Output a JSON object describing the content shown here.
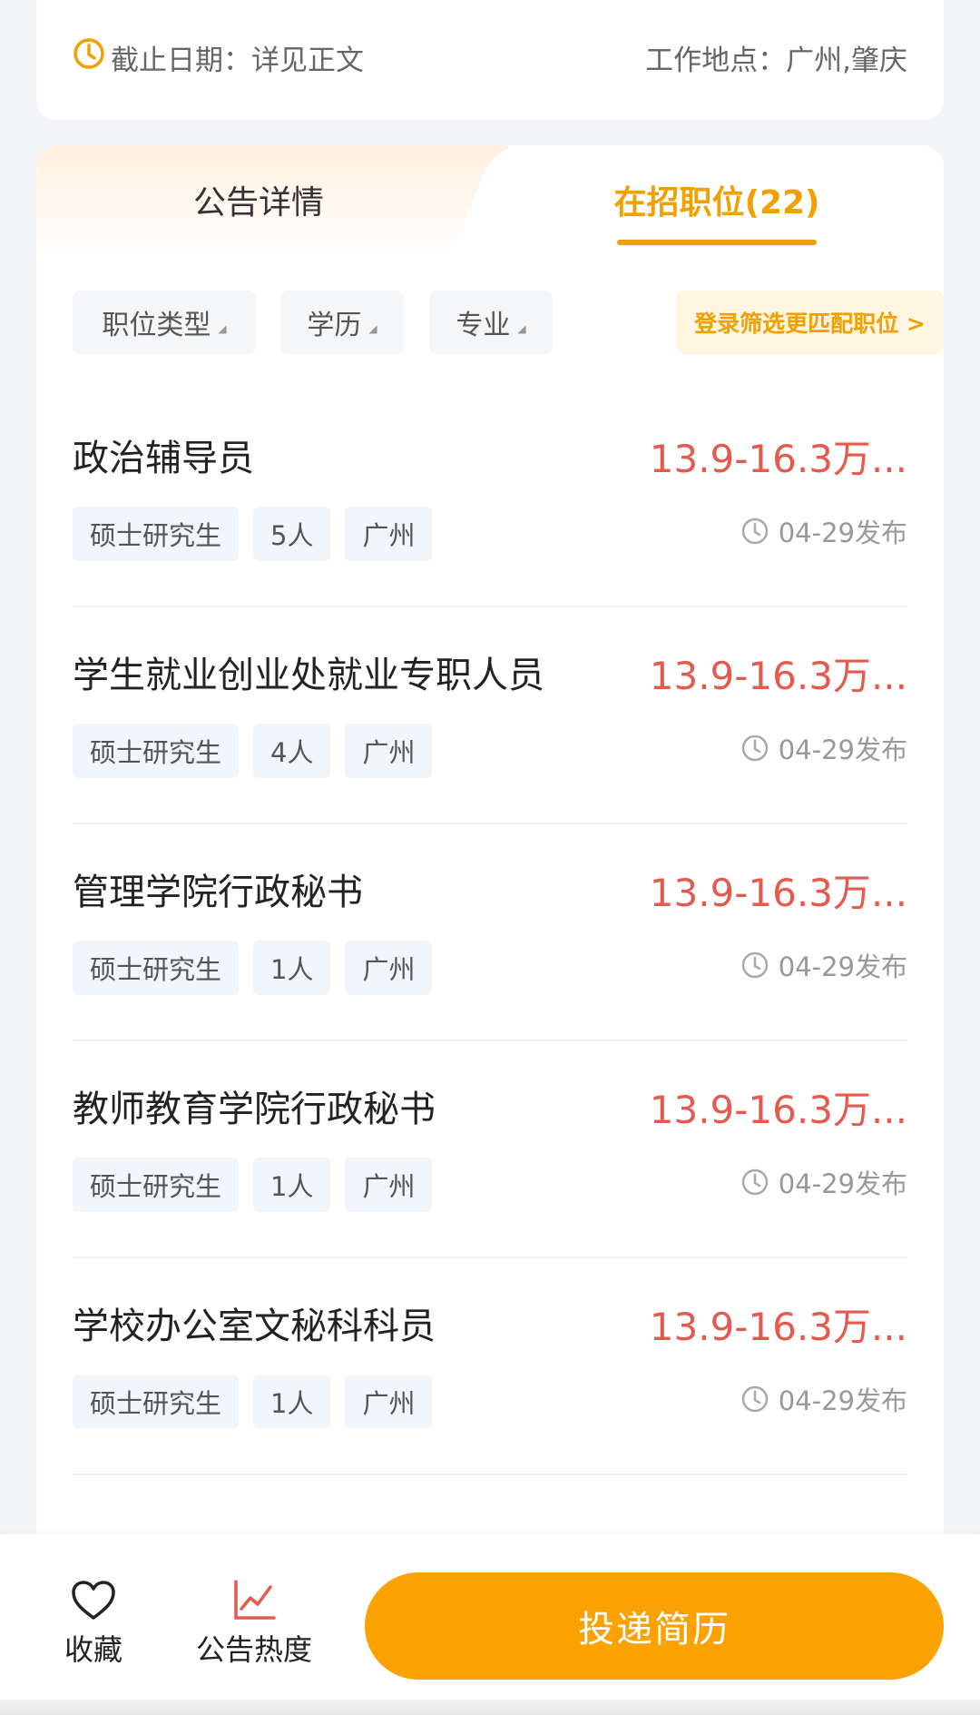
{
  "header": {
    "deadline_text": "截止日期：详见正文",
    "location_text": "工作地点：广州,肇庆"
  },
  "tabs": [
    {
      "label": "公告详情"
    },
    {
      "label": "在招职位(22)"
    }
  ],
  "filters": {
    "type_label": "职位类型",
    "edu_label": "学历",
    "major_label": "专业",
    "login_label": "登录筛选更匹配职位 >"
  },
  "jobs": [
    {
      "title": "政治辅导员",
      "salary": "13.9-16.3万...",
      "edu": "硕士研究生",
      "count": "5人",
      "city": "广州",
      "date": "04-29发布"
    },
    {
      "title": "学生就业创业处就业专职人员",
      "salary": "13.9-16.3万...",
      "edu": "硕士研究生",
      "count": "4人",
      "city": "广州",
      "date": "04-29发布"
    },
    {
      "title": "管理学院行政秘书",
      "salary": "13.9-16.3万...",
      "edu": "硕士研究生",
      "count": "1人",
      "city": "广州",
      "date": "04-29发布"
    },
    {
      "title": "教师教育学院行政秘书",
      "salary": "13.9-16.3万...",
      "edu": "硕士研究生",
      "count": "1人",
      "city": "广州",
      "date": "04-29发布"
    },
    {
      "title": "学校办公室文秘科科员",
      "salary": "13.9-16.3万...",
      "edu": "硕士研究生",
      "count": "1人",
      "city": "广州",
      "date": "04-29发布"
    }
  ],
  "bottom": {
    "favorite_label": "收藏",
    "heat_label": "公告热度",
    "submit_label": "投递简历"
  },
  "colors": {
    "accent": "#f0a000",
    "salary": "#e55a4e",
    "button": "#fba200"
  }
}
